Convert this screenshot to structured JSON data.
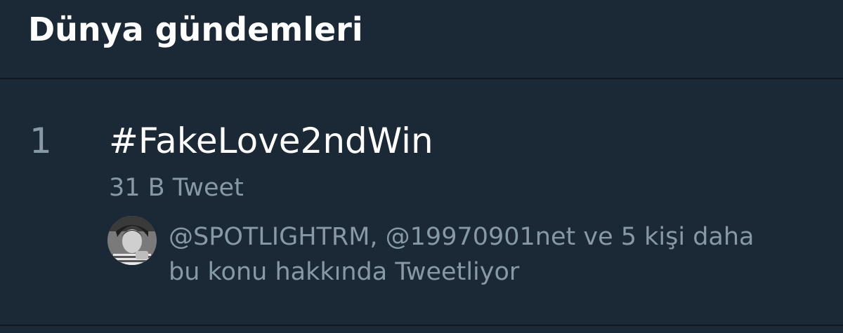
{
  "header": {
    "title": "Dünya gündemleri"
  },
  "trend": {
    "rank": "1",
    "name": "#FakeLove2ndWin",
    "tweet_count": "31 B Tweet",
    "context_line1": "@SPOTLIGHTRM, @19970901net ve 5 kişi daha",
    "context_line2": "bu konu hakkında Tweetliyor"
  },
  "colors": {
    "background": "#1b2836",
    "primary_text": "#ffffff",
    "secondary_text": "#8899a6",
    "divider": "#0f161e"
  }
}
